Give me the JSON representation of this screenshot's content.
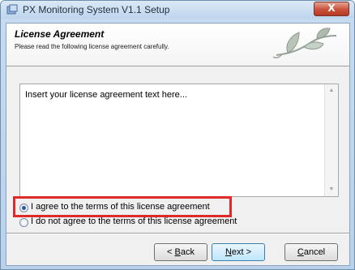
{
  "window": {
    "title": "PX Monitoring System V1.1 Setup",
    "close_glyph": "X"
  },
  "header": {
    "title": "License Agreement",
    "subtitle": "Please read the following license agreement carefully.",
    "art_icon": "leaf-vine-icon"
  },
  "license": {
    "text": "Insert your license agreement text here..."
  },
  "options": {
    "agree_label": "I agree to the terms of this license agreement",
    "agree_selected": true,
    "disagree_label": "I do not agree to the terms of this license agreement",
    "disagree_selected": false
  },
  "buttons": {
    "back_accel": "B",
    "back_rest": "ack",
    "back_prefix": "< ",
    "next_accel": "N",
    "next_rest": "ext >",
    "cancel_accel": "C",
    "cancel_rest": "ancel"
  },
  "colors": {
    "highlight": "#e02a2a",
    "title_bar": "#c7dcf0",
    "close_button": "#c9503a"
  }
}
